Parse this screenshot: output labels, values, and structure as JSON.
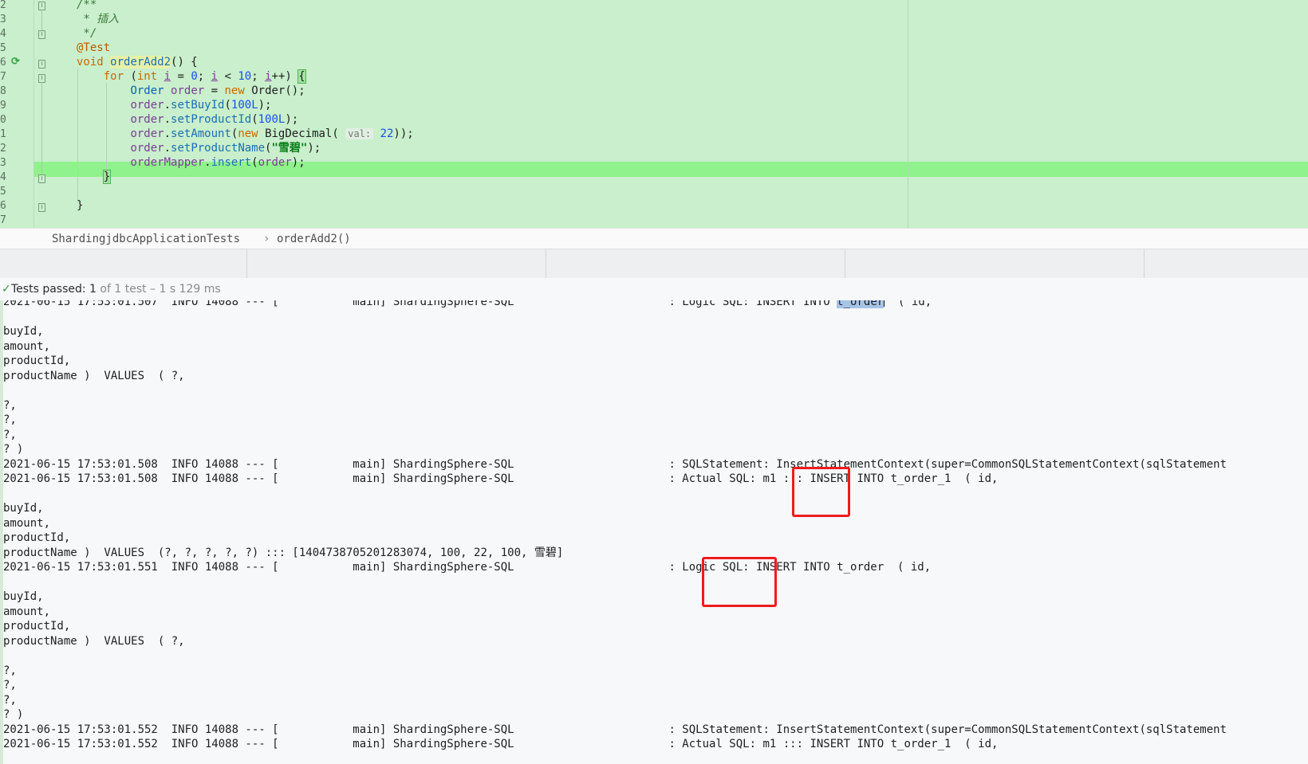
{
  "editor": {
    "line_numbers": [
      "2",
      "3",
      "4",
      "5",
      "6",
      "7",
      "8",
      "9",
      "0",
      "1",
      "2",
      "3",
      "4",
      "5",
      "6",
      "7"
    ],
    "code_lines": [
      {
        "text": "/**"
      },
      {
        "text": " * 插入"
      },
      {
        "text": " */"
      },
      {
        "text": "@Test"
      },
      {
        "text": "void orderAdd2() {"
      },
      {
        "text": "    for (int i = 0; i < 10; i++) {"
      },
      {
        "text": "        Order order = new Order();"
      },
      {
        "text": "        order.setBuyId(100L);"
      },
      {
        "text": "        order.setProductId(100L);"
      },
      {
        "text": "        order.setAmount(new BigDecimal( val: 22));"
      },
      {
        "text": "        order.setProductName(\"雪碧\");"
      },
      {
        "text": "        orderMapper.insert(order);"
      },
      {
        "text": "    }"
      },
      {
        "text": ""
      },
      {
        "text": "}"
      }
    ],
    "tokens": {
      "doc_open": "/**",
      "doc_body": " * 插入",
      "doc_close": " */",
      "annotation": "@Test",
      "void_kw": "void",
      "method_name": "orderAdd2",
      "method_sig_rest": "() {",
      "for_kw": "for",
      "int_kw": "int",
      "loop_var": "i",
      "zero": "0",
      "ten": "10",
      "class_order": "Order",
      "var_order": "order",
      "new_kw": "new",
      "ctor_rest": "Order();",
      "set_buy_id": "setBuyId",
      "set_product_id": "setProductId",
      "set_amount": "setAmount",
      "set_product_name": "setProductName",
      "hundred_l": "100L",
      "big_decimal": "BigDecimal(",
      "param_hint": "val:",
      "twenty_two": "22",
      "product_name_str": "\"雪碧\"",
      "mapper_field": "orderMapper",
      "insert_fn": "insert",
      "close_brace": "}"
    },
    "colors": {
      "background": "#c9efcc",
      "current_line": "#8ff28c",
      "keyword": "#c96a00",
      "method": "#1a6fb5",
      "field": "#7b3c95",
      "number": "#1750eb",
      "string": "#067d17"
    }
  },
  "breadcrumb": {
    "items": [
      "ShardingjdbcApplicationTests",
      "orderAdd2()"
    ],
    "separator": "›"
  },
  "test_status": {
    "icon": "check-icon",
    "label": "Tests passed:",
    "passed": "1",
    "rest": "of 1 test – 1 s 129 ms"
  },
  "console": {
    "lines": [
      "2021-06-15 17:53:01.507  INFO 14088 --- [           main] ShardingSphere-SQL                       : Logic SQL: INSERT INTO ",
      "",
      "buyId,",
      "amount,",
      "productId,",
      "productName )  VALUES  ( ?,",
      "",
      "?,",
      "?,",
      "?,",
      "? )",
      "2021-06-15 17:53:01.508  INFO 14088 --- [           main] ShardingSphere-SQL                       : SQLStatement: InsertStatementContext(super=CommonSQLStatementContext(sqlStatement",
      "2021-06-15 17:53:01.508  INFO 14088 --- [           main] ShardingSphere-SQL                       : Actual SQL: m1 ::: INSERT INTO t_order_1  ( id,",
      "",
      "buyId,",
      "amount,",
      "productId,",
      "productName )  VALUES  (?, ?, ?, ?, ?) ::: [1404738705201283074, 100, 22, 100, 雪碧]",
      "2021-06-15 17:53:01.551  INFO 14088 --- [           main] ShardingSphere-SQL                       : Logic SQL: INSERT INTO t_order  ( id,",
      "",
      "buyId,",
      "amount,",
      "productId,",
      "productName )  VALUES  ( ?,",
      "",
      "?,",
      "?,",
      "?,",
      "? )",
      "2021-06-15 17:53:01.552  INFO 14088 --- [           main] ShardingSphere-SQL                       : SQLStatement: InsertStatementContext(super=CommonSQLStatementContext(sqlStatement",
      "2021-06-15 17:53:01.552  INFO 14088 --- [           main] ShardingSphere-SQL                       : Actual SQL: m1 ::: INSERT INTO t_order_1  ( id,"
    ],
    "first_line_selected": "t_order",
    "first_line_tail": "  ( id,",
    "highlight_color": "#ee1c1c"
  }
}
